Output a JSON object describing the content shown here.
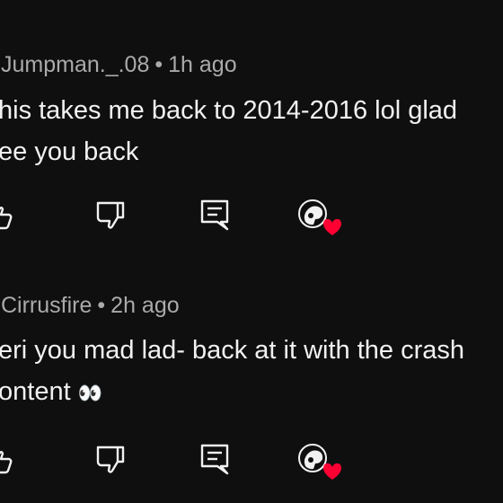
{
  "comments": [
    {
      "author": "Jumpman._.08",
      "separator": "•",
      "time": "1h ago",
      "line1": "his takes me back to 2014-2016 lol glad",
      "line2": "ee you back",
      "creator_hearted": true
    },
    {
      "author": "Cirrusfire",
      "separator": "•",
      "time": "2h ago",
      "line1": "eri you mad lad- back at it with the crash",
      "line2": "ontent",
      "emoji": "👀",
      "creator_hearted": true
    }
  ],
  "icons": {
    "like": "thumbs-up-icon",
    "dislike": "thumbs-down-icon",
    "reply": "reply-comment-icon",
    "heart": "creator-heart-icon"
  },
  "colors": {
    "background": "#0f0f0f",
    "text": "#f1f1f1",
    "meta": "#aaaaaa",
    "heart": "#ff0033"
  }
}
